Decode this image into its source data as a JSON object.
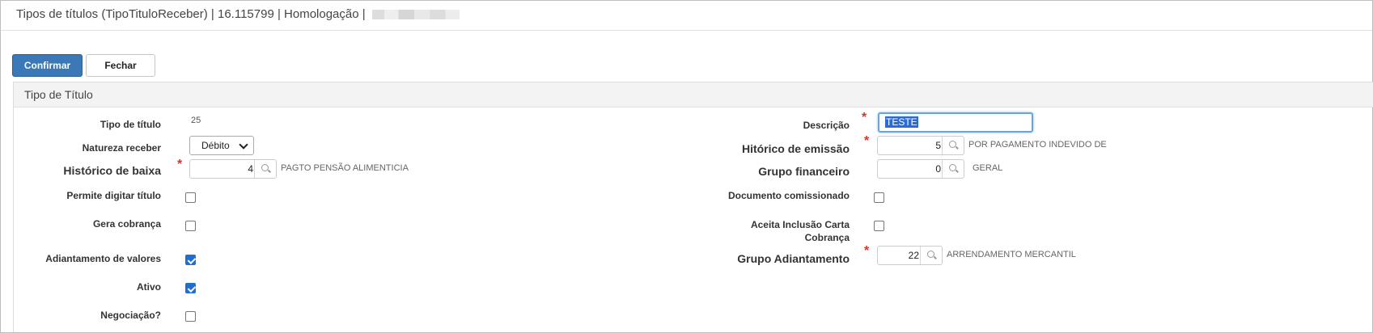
{
  "window": {
    "title": "Tipos de títulos (TipoTituloReceber) | 16.115799 | Homologação |"
  },
  "toolbar": {
    "confirm_label": "Confirmar",
    "close_label": "Fechar"
  },
  "panel": {
    "title": "Tipo de Título"
  },
  "left": {
    "tipo_titulo": {
      "label": "Tipo de título",
      "value": "25"
    },
    "natureza": {
      "label": "Natureza receber",
      "value": "Débito"
    },
    "historico_baixa": {
      "label": "Histórico de baixa",
      "value": "4",
      "description": "PAGTO PENSÃO ALIMENTICIA",
      "required": true
    },
    "permite_digitar": {
      "label": "Permite digitar título",
      "checked": false
    },
    "gera_cobranca": {
      "label": "Gera cobrança",
      "checked": false
    },
    "adiantamento": {
      "label": "Adiantamento de valores",
      "checked": true
    },
    "ativo": {
      "label": "Ativo",
      "checked": true
    },
    "negociacao": {
      "label": "Negociação?",
      "checked": false
    }
  },
  "right": {
    "descricao": {
      "label": "Descrição",
      "value": "TESTE",
      "required": true
    },
    "historico_emissao": {
      "label": "Hitórico de emissão",
      "value": "5",
      "description": "POR PAGAMENTO INDEVIDO DE",
      "required": true
    },
    "grupo_financeiro": {
      "label": "Grupo financeiro",
      "value": "0",
      "description": "GERAL"
    },
    "documento_comissionado": {
      "label": "Documento comissionado",
      "checked": false
    },
    "aceita_inclusao": {
      "label_line1": "Aceita Inclusão Carta",
      "label_line2": "Cobrança",
      "checked": false
    },
    "grupo_adiantamento": {
      "label": "Grupo Adiantamento",
      "value": "22",
      "description": "ARRENDAMENTO MERCANTIL",
      "required": true
    }
  },
  "required_marker": "*",
  "icons": {
    "lookup": "search-icon",
    "dropdown": "chevron-down-icon",
    "checkbox_on": "check-icon"
  },
  "colors": {
    "primary": "#3a78b8",
    "required": "#d9342b",
    "checkbox": "#1f6fd0",
    "focus": "#6da2e0"
  }
}
